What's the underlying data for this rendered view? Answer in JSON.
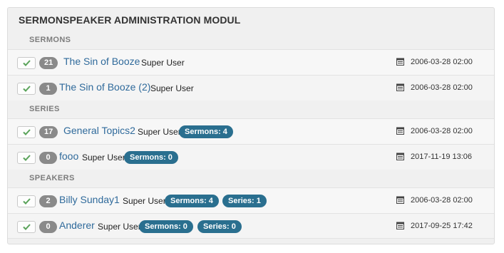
{
  "module": {
    "title": "SERMONSPEAKER ADMINISTRATION MODUL"
  },
  "sections": {
    "sermons": {
      "header": "SERMONS",
      "rows": [
        {
          "hits": "21",
          "title": "The Sin of Booze",
          "author": "Super User",
          "date": "2006-03-28 02:00"
        },
        {
          "hits": "1",
          "title": "The Sin of Booze (2)",
          "author": "Super User",
          "date": "2006-03-28 02:00"
        }
      ]
    },
    "series": {
      "header": "SERIES",
      "rows": [
        {
          "hits": "17",
          "title": "General Topics2",
          "author": "Super User",
          "badge1": "Sermons: 4",
          "date": "2006-03-28 02:00"
        },
        {
          "hits": "0",
          "title": "fooo",
          "author": "Super User",
          "badge1": "Sermons: 0",
          "date": "2017-11-19 13:06"
        }
      ]
    },
    "speakers": {
      "header": "SPEAKERS",
      "rows": [
        {
          "hits": "2",
          "title": "Billy Sunday1",
          "author": "Super User",
          "badge1": "Sermons: 4",
          "badge2": "Series: 1",
          "date": "2006-03-28 02:00"
        },
        {
          "hits": "0",
          "title": "Anderer",
          "author": "Super User",
          "badge1": "Sermons: 0",
          "badge2": "Series: 0",
          "date": "2017-09-25 17:42"
        }
      ]
    }
  },
  "icons": {
    "publish": "check-icon",
    "date": "calendar-icon"
  },
  "colors": {
    "link": "#2f6a9b",
    "count_badge": "#2a6f8f",
    "hits_badge": "#8a8a8a",
    "check": "#5aa35a"
  }
}
